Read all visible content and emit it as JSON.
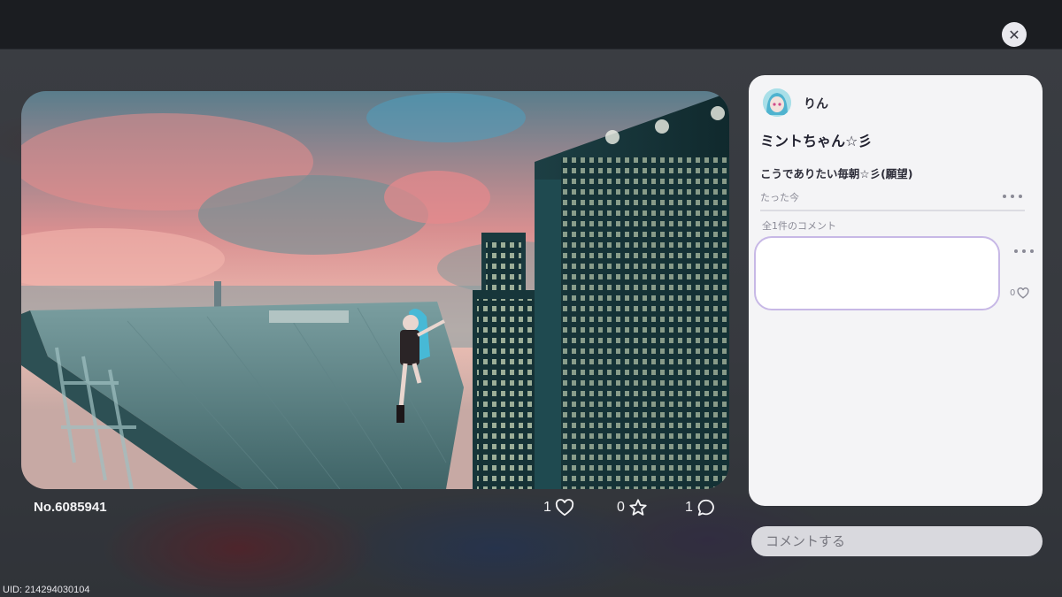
{
  "viewer": {
    "photo_number": "No.6085941",
    "likes": "1",
    "favorites": "0",
    "comments": "1",
    "uid": "UID: 214294030104"
  },
  "post": {
    "user_name": "りん",
    "title": "ミントちゃん☆彡",
    "body": "こうでありたい毎朝☆彡(願望)",
    "time": "たった今"
  },
  "comments_section": {
    "count_label": "全1件のコメント",
    "comment_likes": "0"
  },
  "comment_input": {
    "placeholder": "コメントする"
  },
  "icons": {
    "close": "close-icon",
    "like": "heart-icon",
    "favorite": "star-icon",
    "comment": "speech-bubble-icon",
    "more": "more-dots-icon"
  },
  "colors": {
    "panel_bg": "#f4f4f6",
    "comment_border": "#c7b8e6",
    "input_bg": "#d9d9de"
  }
}
